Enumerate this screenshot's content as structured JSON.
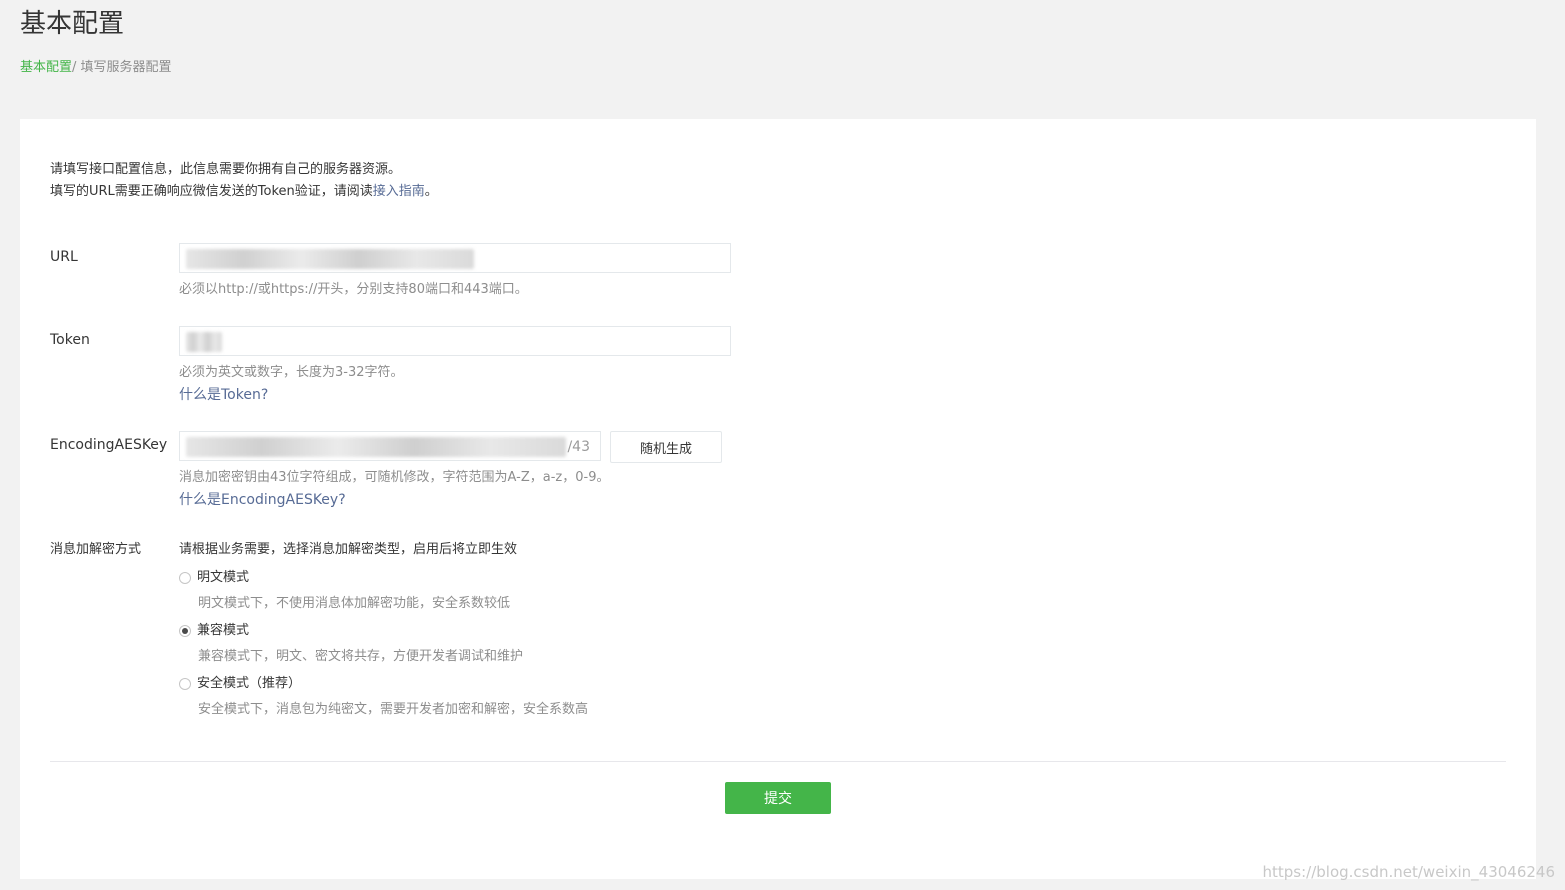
{
  "header": {
    "title": "基本配置",
    "breadcrumb_link": "基本配置",
    "breadcrumb_sep": "/ ",
    "breadcrumb_current": "填写服务器配置"
  },
  "intro": {
    "line1": "请填写接口配置信息，此信息需要你拥有自己的服务器资源。",
    "line2_prefix": "填写的URL需要正确响应微信发送的Token验证，请阅读",
    "line2_link": "接入指南",
    "line2_suffix": "。"
  },
  "url": {
    "label": "URL",
    "tip": "必须以http://或https://开头，分别支持80端口和443端口。"
  },
  "token": {
    "label": "Token",
    "tip": "必须为英文或数字，长度为3-32字符。",
    "help_link": "什么是Token?"
  },
  "aeskey": {
    "label": "EncodingAESKey",
    "counter": "/43",
    "generate_label": "随机生成",
    "tip": "消息加密密钥由43位字符组成，可随机修改，字符范围为A-Z，a-z，0-9。",
    "help_link": "什么是EncodingAESKey?"
  },
  "encryption": {
    "label": "消息加解密方式",
    "description": "请根据业务需要，选择消息加解密类型，启用后将立即生效",
    "options": [
      {
        "label": "明文模式",
        "desc": "明文模式下，不使用消息体加解密功能，安全系数较低",
        "checked": false
      },
      {
        "label": "兼容模式",
        "desc": "兼容模式下，明文、密文将共存，方便开发者调试和维护",
        "checked": true
      },
      {
        "label": "安全模式（推荐）",
        "desc": "安全模式下，消息包为纯密文，需要开发者加密和解密，安全系数高",
        "checked": false
      }
    ]
  },
  "submit_label": "提交",
  "watermark": "https://blog.csdn.net/weixin_43046246",
  "colors": {
    "primary": "#44b549",
    "link": "#576b95",
    "tip": "#8d8d8d",
    "border": "#e4e8eb"
  }
}
